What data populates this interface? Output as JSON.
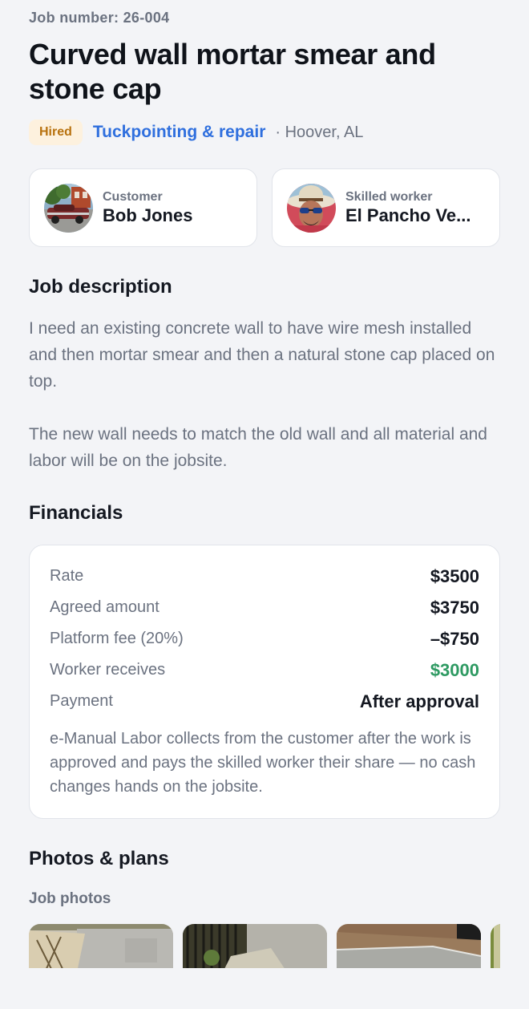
{
  "job": {
    "number_label": "Job number: 26-004",
    "title": "Curved wall mortar smear and stone cap",
    "status_badge": "Hired",
    "category": "Tuckpointing & repair",
    "location": "· Hoover, AL"
  },
  "customer": {
    "role": "Customer",
    "name": "Bob Jones"
  },
  "worker": {
    "role": "Skilled worker",
    "name": "El Pancho Ve..."
  },
  "description": {
    "heading": "Job description",
    "paragraphs": [
      "I need an existing concrete wall to have wire mesh installed and then mortar smear and then a natural stone cap placed on top.",
      "The new wall needs to match the old wall and all material and labor will be on the jobsite."
    ]
  },
  "financials": {
    "heading": "Financials",
    "rows": [
      {
        "label": "Rate",
        "value": "$3500"
      },
      {
        "label": "Agreed amount",
        "value": "$3750"
      },
      {
        "label": "Platform fee (20%)",
        "value": "–$750"
      },
      {
        "label": "Worker receives",
        "value": "$3000"
      },
      {
        "label": "Payment",
        "value": "After approval"
      }
    ],
    "note": "e-Manual Labor collects from the customer after the work is approved and pays the skilled worker their share — no cash changes hands on the jobsite."
  },
  "photos": {
    "heading": "Photos & plans",
    "subheading": "Job photos"
  },
  "colors": {
    "accent_blue": "#2f6fde",
    "badge_bg": "#fdf1de",
    "badge_text": "#b8720f",
    "positive_green": "#2e9a62",
    "muted_text": "#6b7280",
    "background": "#f3f4f7"
  }
}
